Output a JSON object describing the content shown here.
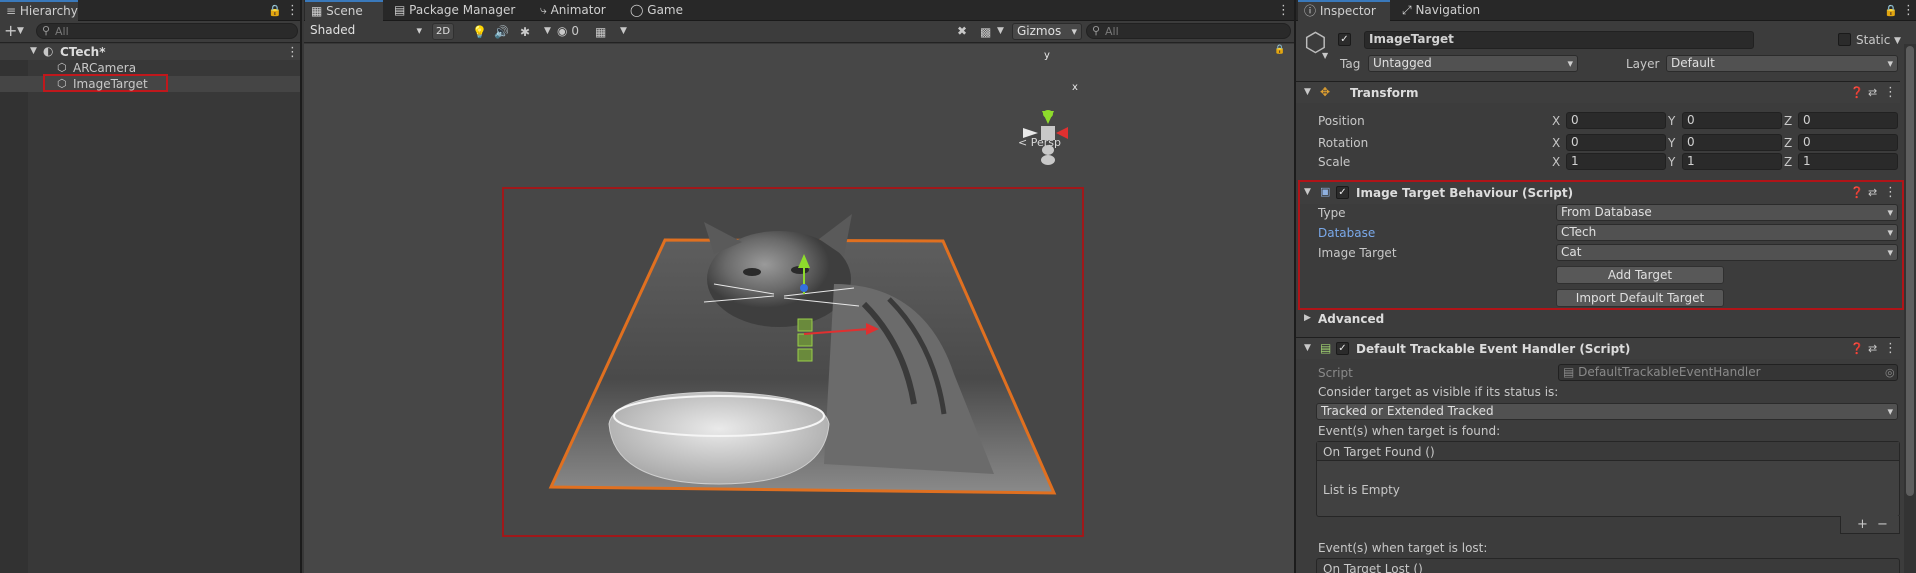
{
  "hierarchy": {
    "tab_label": "Hierarchy",
    "search_placeholder": "All",
    "scene_name": "CTech*",
    "items": [
      "ARCamera",
      "ImageTarget"
    ]
  },
  "center_tabs": [
    "Scene",
    "Package Manager",
    "Animator",
    "Game"
  ],
  "scene_toolbar": {
    "shading_mode": "Shaded",
    "mode_2d": "2D",
    "hidden_count": "0",
    "gizmos_label": "Gizmos",
    "search_placeholder": "All"
  },
  "scene_view": {
    "gizmo_axis_y": "y",
    "gizmo_axis_x": "x",
    "projection_label": "Persp"
  },
  "inspector": {
    "tabs": [
      "Inspector",
      "Navigation"
    ],
    "object_name": "ImageTarget",
    "static_label": "Static",
    "tag_label": "Tag",
    "tag_value": "Untagged",
    "layer_label": "Layer",
    "layer_value": "Default",
    "transform": {
      "title": "Transform",
      "rows": [
        {
          "label": "Position",
          "x": "0",
          "y": "0",
          "z": "0"
        },
        {
          "label": "Rotation",
          "x": "0",
          "y": "0",
          "z": "0"
        },
        {
          "label": "Scale",
          "x": "1",
          "y": "1",
          "z": "1"
        }
      ],
      "axis_x": "X",
      "axis_y": "Y",
      "axis_z": "Z"
    },
    "image_target_behaviour": {
      "title": "Image Target Behaviour (Script)",
      "type_label": "Type",
      "type_value": "From Database",
      "database_label": "Database",
      "database_value": "CTech",
      "image_target_label": "Image Target",
      "image_target_value": "Cat",
      "add_target_button": "Add Target",
      "import_default_button": "Import Default Target"
    },
    "advanced_label": "Advanced",
    "event_handler": {
      "title": "Default Trackable Event Handler (Script)",
      "script_label": "Script",
      "script_value": "DefaultTrackableEventHandler",
      "consider_label": "Consider target as visible if its status is:",
      "status_value": "Tracked or Extended Tracked",
      "found_label": "Event(s) when target is found:",
      "found_event": "On Target Found ()",
      "list_empty": "List is Empty",
      "lost_label": "Event(s) when target is lost:",
      "lost_event": "On Target Lost ()"
    }
  },
  "colors": {
    "highlight_red": "#c0181c",
    "accent_blue": "#3a79bb",
    "target_outline": "#e07020"
  }
}
